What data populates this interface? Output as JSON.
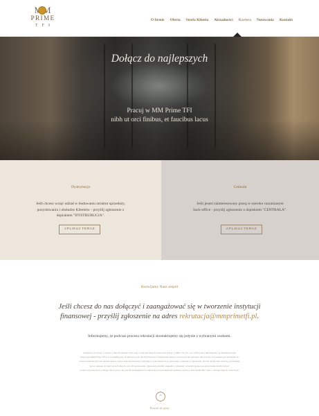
{
  "header": {
    "logo": {
      "line1": "MM",
      "line2": "PRIME",
      "line3": "TFI"
    },
    "nav": [
      {
        "label": "O firmie"
      },
      {
        "label": "Oferta"
      },
      {
        "label": "Strefa Klienta"
      },
      {
        "label": "Aktualności"
      },
      {
        "label": "Kariera",
        "active": true
      },
      {
        "label": "Notowania"
      },
      {
        "label": "Kontakt"
      }
    ]
  },
  "hero": {
    "title": "Dołącz do najlepszych",
    "subtitle_line1": "Pracuj w MM Prime TFI",
    "subtitle_line2": "nibh ut orci finibus, et faucibus lacus"
  },
  "panels": {
    "left": {
      "heading": "Dystrybucja",
      "text_lines": [
        "Jeśli chcesz wziąć udział w budowaniu struktur sprzedaży,",
        "pozyskiwaniu i obsłudze Klientów - przyślij zgłoszenie z",
        "dopiskiem \"DYSTRUBUCJA\"."
      ],
      "button": "APLIKUJ TERAZ"
    },
    "right": {
      "heading": "Centrala",
      "text_lines": [
        "Jeśli jesteś zainteresowany pracą w szeroko rozumianym",
        "back-office - przyślij zgłoszenie z dopiskiem \"CENTRALA\"."
      ],
      "button": "APLIKUJ TERAZ"
    }
  },
  "invite": {
    "label": "Rozwijamy Nasz zespół",
    "line1": "Jeśli chcesz do nas dołączyć i zaangażować się w tworzenie instytucji",
    "line2_prefix": "finansowej - przyślij zgłoszenie na adres ",
    "email": "rekrutacja@mmprimetfi.pl",
    "line2_suffix": ".",
    "info": "Informujemy, że podczas procesu rekrutacji skontaktujemy się jedynie z wybranymi osobami."
  },
  "legal_lines": [
    "Zgodnie z art. 24 ust. 1 ustawy z dnia 29 sierpnia 1997 roku o ochronie danych osobowych (Dz.U. z 2002 r. Nr 101, poz. 926 ze zm.) informujemy, że administratorem",
    "danych jest MM Prime TFI S.A. z siedzibą przy ul. Klonowej 24, 03-204 Warszawa. Przekazanie danych osobowych ma charakter dobrowolny, ich podanie jest niezbędne do",
    "przeprowadzenia procesu rekrutacyjnego. Dane będą przetwarzane wyłącznie w celu rekrutacji na stanowisko wskazane w zgłoszeniu. Osobie, której dane dotyczą, przysługuje",
    "prawo dostępu do treści swoich danych oraz ich poprawiania. Zgłoszenia prosimy uzupełnić o klauzulę: wyrażam zgodę na przetwarzanie moich danych",
    "osobowych zawartych w mojej ofercie pracy dla potrzeb niezbędnych do realizacji procesu rekrutacji zgodnie z ustawą z dnia 29.08.1997 roku o ochronie danych osobowych."
  ],
  "scroll": {
    "icon": "chevron-up-icon",
    "label": "Powrót do góry"
  },
  "colors": {
    "accent": "#8a6a3c",
    "panel_left": "#ece6dd",
    "panel_right": "#d6d1cc",
    "email": "#b08958"
  }
}
